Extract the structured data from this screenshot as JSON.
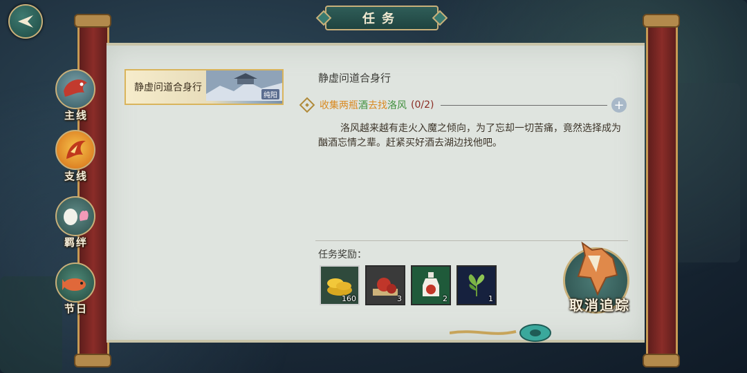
{
  "window": {
    "title": "任务"
  },
  "quest_list": [
    {
      "name": "静虚问道合身行",
      "tag": "纯阳"
    }
  ],
  "detail": {
    "title": "静虚问道合身行",
    "objective": {
      "part1": "收集两瓶",
      "part2": "酒",
      "part3": "去找",
      "part4": "洛风",
      "count": "(0/2)"
    },
    "description": "洛风越来越有走火入魔之倾向，为了忘却一切苦痛，竟然选择成为酗酒忘情之辈。赶紧买好酒去湖边找他吧。",
    "reward_label": "任务奖励："
  },
  "rewards": [
    {
      "icon": "gold-ingot-icon",
      "qty": "160"
    },
    {
      "icon": "red-fruit-icon",
      "qty": "3"
    },
    {
      "icon": "wine-bottle-icon",
      "qty": "2"
    },
    {
      "icon": "tea-leaf-icon",
      "qty": "1"
    }
  ],
  "nav": [
    {
      "label": "主线",
      "icon": "dragon-icon"
    },
    {
      "label": "支线",
      "icon": "phoenix-icon"
    },
    {
      "label": "羁绊",
      "icon": "crane-lotus-icon"
    },
    {
      "label": "节日",
      "icon": "koi-fish-icon"
    }
  ],
  "cancel_track": {
    "label": "取消追踪"
  },
  "colors": {
    "orange": "#d98a22",
    "green": "#3f8f3c",
    "count": "#8a2a22",
    "gold": "#c9b07a"
  }
}
